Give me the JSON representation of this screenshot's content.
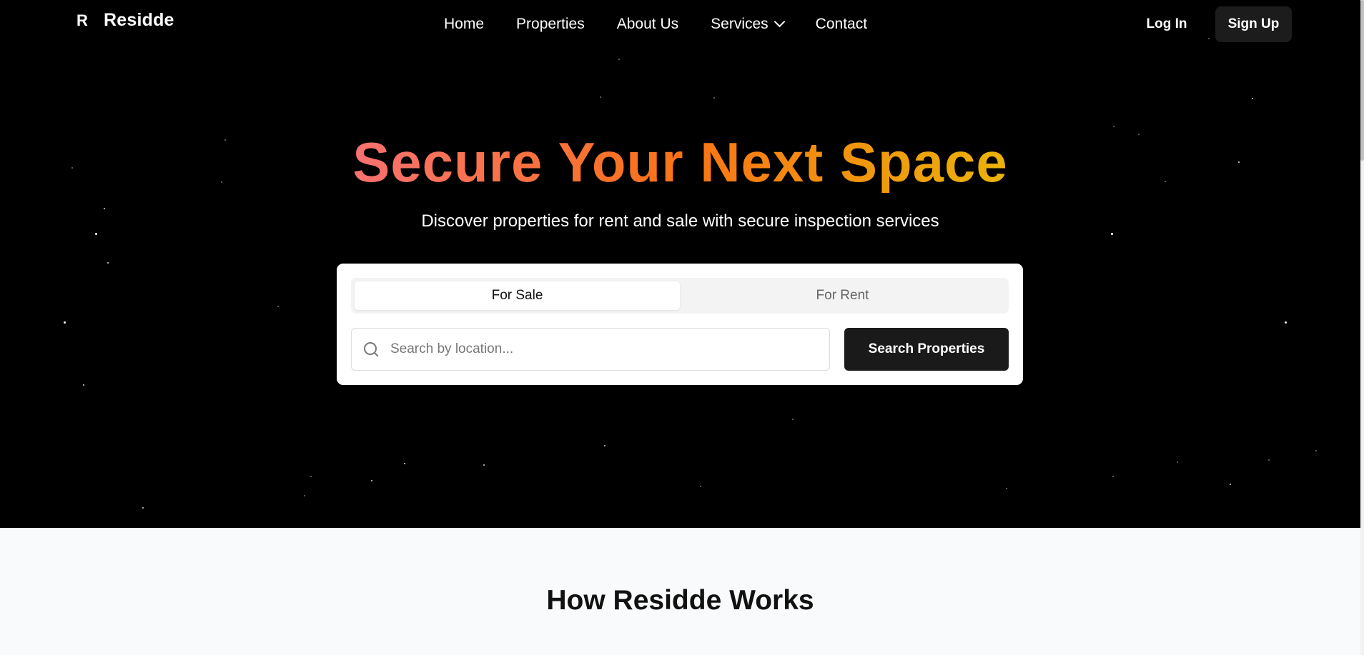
{
  "nav": {
    "logo_mark": "R",
    "logo_text": "Residde",
    "links": [
      "Home",
      "Properties",
      "About Us",
      "Services",
      "Contact"
    ],
    "login": "Log In",
    "signup": "Sign Up"
  },
  "hero": {
    "headline": "Secure Your Next Space",
    "subhead": "Discover properties for rent and sale with secure inspection services"
  },
  "search": {
    "tabs": [
      "For Sale",
      "For Rent"
    ],
    "active_tab": "For Sale",
    "placeholder": "Search by location...",
    "button": "Search Properties"
  },
  "section": {
    "title": "How Residde Works"
  },
  "colors": {
    "gradient_start": "#f87171",
    "gradient_mid": "#f97316",
    "gradient_end": "#eab308",
    "hero_bg": "#000000",
    "button_dark": "#1a1a1a"
  }
}
